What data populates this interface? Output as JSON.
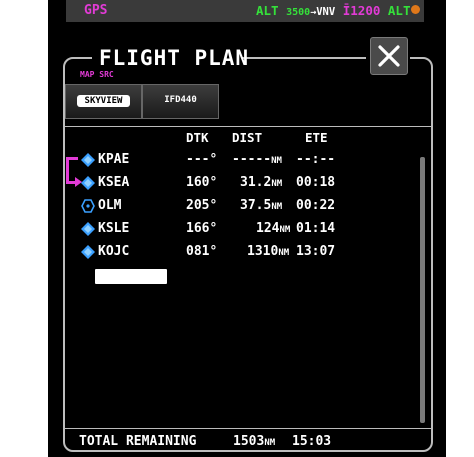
{
  "status_bar": {
    "gps": "GPS",
    "alt_label": "ALT",
    "alt_value": "3500",
    "arrow": "→",
    "vnv": "VNV",
    "bug": "Ī",
    "alt_target": "1200",
    "alt_mode": "ALT"
  },
  "dialog": {
    "title": "FLIGHT PLAN",
    "close_label": "✕"
  },
  "map_src": {
    "label": "MAP SRC",
    "options": [
      "SKYVIEW",
      "IFD440"
    ],
    "selected": "SKYVIEW"
  },
  "table": {
    "headers": {
      "dtk": "DTK",
      "dist": "DIST",
      "ete": "ETE"
    },
    "rows": [
      {
        "waypoint": "KPAE",
        "dtk": "---°",
        "dist": "-----",
        "unit": "NM",
        "ete": "--:--",
        "icon": "airport-icon"
      },
      {
        "waypoint": "KSEA",
        "dtk": "160°",
        "dist": "31.2",
        "unit": "NM",
        "ete": "00:18",
        "icon": "airport-icon"
      },
      {
        "waypoint": "OLM",
        "dtk": "205°",
        "dist": "37.5",
        "unit": "NM",
        "ete": "00:22",
        "icon": "vor-icon"
      },
      {
        "waypoint": "KSLE",
        "dtk": "166°",
        "dist": "124",
        "unit": "NM",
        "ete": "01:14",
        "icon": "airport-icon"
      },
      {
        "waypoint": "KOJC",
        "dtk": "081°",
        "dist": "1310",
        "unit": "NM",
        "ete": "13:07",
        "icon": "airport-icon"
      }
    ]
  },
  "footer": {
    "label": "TOTAL REMAINING",
    "dist": "1503",
    "unit": "NM",
    "ete": "15:03"
  },
  "colors": {
    "magenta": "#e23bd6",
    "green": "#35e03a",
    "airport_blue": "#3ba0ff"
  }
}
